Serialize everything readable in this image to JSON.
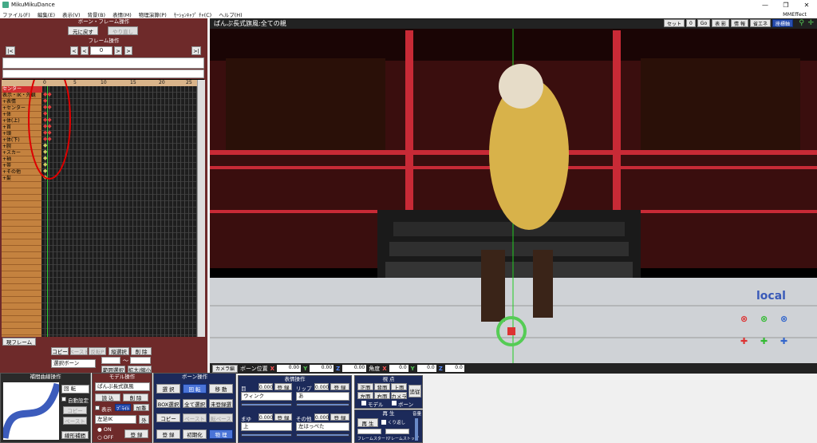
{
  "window": {
    "title": "MikuMikuDance",
    "min": "—",
    "max": "❐",
    "close": "✕"
  },
  "menu": {
    "items": [
      "ファイル(F)",
      "編集(E)",
      "表示(V)",
      "背景(B)",
      "表情(M)",
      "物理演算(P)",
      "ﾓｰｼｮﾝｷｬﾌﾟ ﾁｬ(C)",
      "ヘルプ(H)"
    ],
    "right": "MMEffect"
  },
  "bone_frame": {
    "title": "ボーン・フレーム操作",
    "restore": "元に戻す",
    "redo": "やり直し"
  },
  "frame_op": {
    "title": "フレーム操作",
    "first": "|<",
    "prev": "<",
    "prev_small": "<",
    "frame": "0",
    "next_small": ">",
    "next": ">",
    "last": ">|"
  },
  "timeline": {
    "ticks": [
      "0",
      "5",
      "10",
      "15",
      "20",
      "25"
    ],
    "bones": [
      "センター",
      "表示・IK・外観",
      "+表情",
      "+センター",
      "+体",
      "+体(上)",
      "+首",
      "+頭",
      "+体(下)",
      "+腕",
      "+スカー",
      "+袖",
      "+帯",
      "+その他",
      "+髪"
    ],
    "current_frame_label": "現フレーム"
  },
  "bone_actions": {
    "copy": "コピー",
    "paste": "ペースト",
    "reverse_paste": "反転P",
    "vertical_select": "縦選択",
    "delete": "削 除",
    "select_bone": "選択ボーン",
    "tilde": "〜",
    "range_select": "範囲選択",
    "expand": "拡大/縮小"
  },
  "viewport": {
    "title": "ぱんぷ長式旗風:全ての親",
    "buttons": [
      "セット",
      "0",
      "Go",
      "表 影",
      "情 報",
      "省エネ",
      "座標軸"
    ],
    "local_label": "local"
  },
  "bone_pos": {
    "camera": "カメラ編",
    "label": "ボーン位置",
    "x_label": "X",
    "x": "0.00",
    "y_label": "Y",
    "y": "0.00",
    "z_label": "Z",
    "z": "0.00",
    "angle_label": "角度",
    "ax": "0.0",
    "ay": "0.0",
    "az": "0.0"
  },
  "interp": {
    "title": "補間曲線操作",
    "mode": "回 転",
    "auto_label": "自動設定",
    "copy": "コピー",
    "paste": "ペースト",
    "linear": "線形補間"
  },
  "model_op": {
    "title": "モデル操作",
    "model": "ぱんぷ長式旗風",
    "load": "読 込",
    "delete": "削 除",
    "show_label": "表示",
    "outline": "ﾌﾞﾗｲﾄ",
    "add": "加重",
    "ik": "左足IK",
    "out": "外",
    "on": "ON",
    "off": "OFF",
    "register": "登 録"
  },
  "bone_op": {
    "title": "ボーン操作",
    "select": "選 択",
    "rotate": "回 転",
    "move": "移 動",
    "box_select": "BOX選択",
    "select_all": "全て選択",
    "unregistered": "未登録選",
    "copy": "コピー",
    "paste": "ペースト",
    "reverse": "反転ペースト",
    "register": "登 録",
    "init": "初期化",
    "physics": "物 理"
  },
  "face_op": {
    "title": "表情操作",
    "eye_label": "目",
    "eye_val": "0.000",
    "eye_sel": "ウィンク",
    "lip_label": "リップ",
    "lip_val": "0.000",
    "lip_sel": "あ",
    "brow_label": "まゆ",
    "brow_val": "0.000",
    "brow_sel": "上",
    "other_label": "その他",
    "other_val": "0.000",
    "other_sel": "左はっぺた",
    "register": "登 録"
  },
  "view_op": {
    "title": "視 点",
    "front": "正面",
    "back": "背面",
    "top": "上面",
    "left": "左面",
    "right": "右面",
    "camera": "カメラ",
    "follow": "追従",
    "model": "モデル",
    "bone": "ボーン"
  },
  "play_op": {
    "title": "再 生",
    "play": "再 生",
    "loop": "くり返し",
    "from": "フレームスタート",
    "to": "フレームストップ",
    "volume": "音量"
  },
  "colors": {
    "accent_red": "#6e2a2a",
    "accent_blue": "#1c2a5a",
    "highlight": "#d23030"
  }
}
